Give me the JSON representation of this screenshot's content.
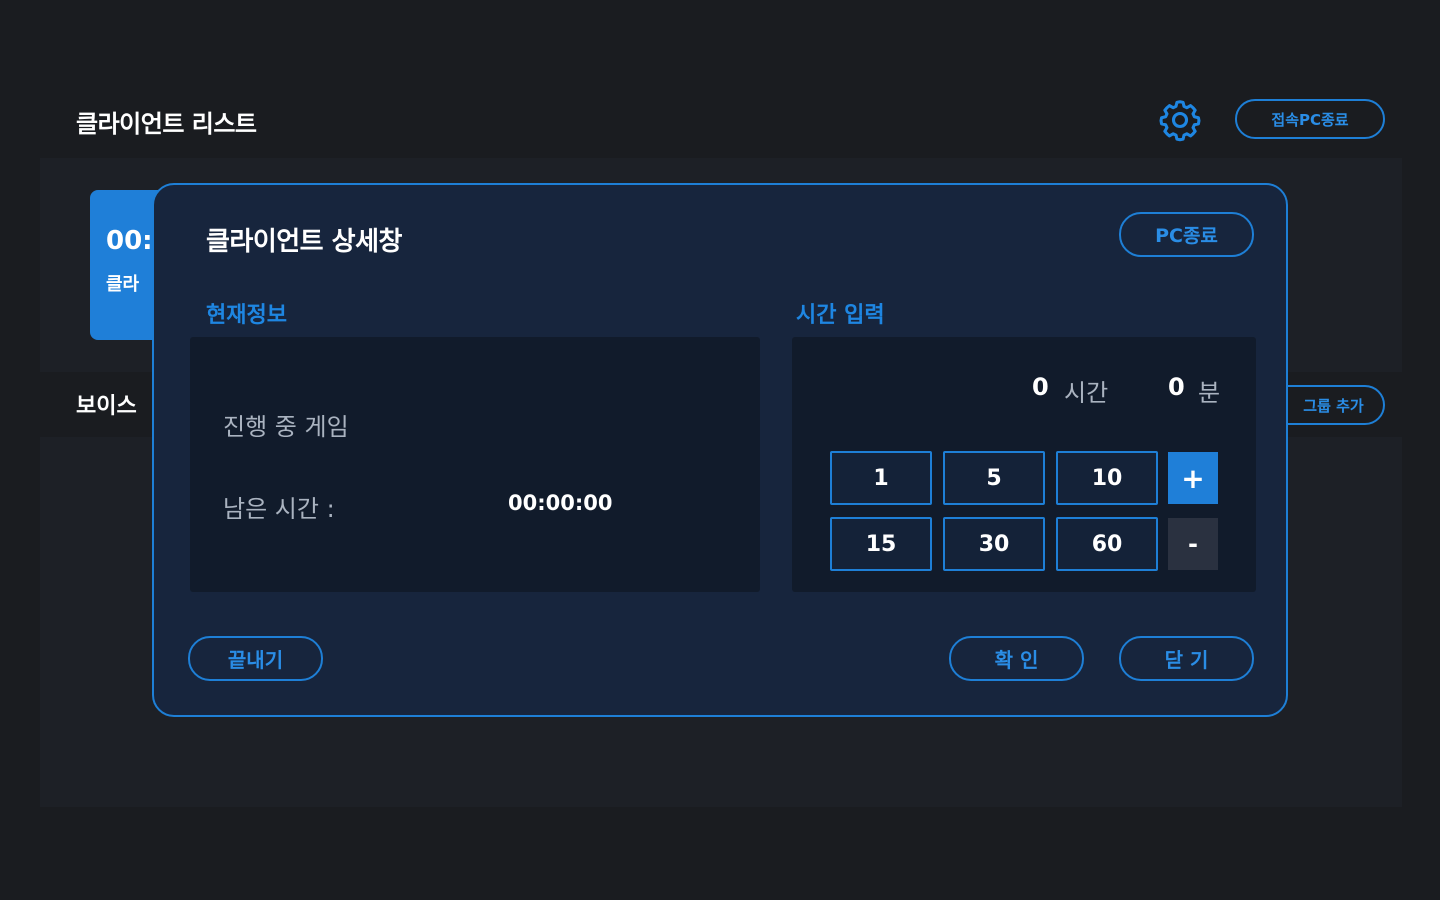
{
  "header": {
    "title": "클라이언트 리스트",
    "settings_icon": "gear-icon",
    "shutdown_all_label": "접속PC종료"
  },
  "client_card": {
    "time": "00:",
    "name": "클라"
  },
  "voice_section": {
    "title": "보이스"
  },
  "group_add_label": "그룹 추가",
  "modal": {
    "title": "클라이언트 상세창",
    "pc_off_label": "PC종료",
    "current_info": {
      "label": "현재정보",
      "game_label": "진행 중 게임",
      "remaining_label": "남은 시간 :",
      "remaining_value": "00:00:00"
    },
    "time_input": {
      "label": "시간 입력",
      "hours_value": "0",
      "hours_unit": "시간",
      "minutes_value": "0",
      "minutes_unit": "분",
      "buttons": [
        "1",
        "5",
        "10",
        "15",
        "30",
        "60"
      ],
      "plus_label": "+",
      "minus_label": "-"
    },
    "footer": {
      "finish_label": "끝내기",
      "confirm_label": "확 인",
      "close_label": "닫 기"
    }
  },
  "colors": {
    "accent": "#1e7fd6",
    "modal_bg": "#17253d",
    "page_bg": "#1a1c20"
  }
}
